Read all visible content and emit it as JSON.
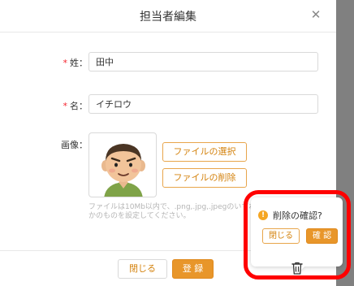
{
  "modal": {
    "title": "担当者編集",
    "close_icon": "close-icon"
  },
  "form": {
    "last_name": {
      "label": "姓：",
      "value": "田中",
      "required": true
    },
    "first_name": {
      "label": "名：",
      "value": "イチロウ",
      "required": true
    },
    "image": {
      "label": "画像：",
      "select_button": "ファイルの選択",
      "delete_button": "ファイルの削除",
      "hint": "ファイルは10Mb以内で、.png,.jpg,.jpegのいずれかのものを設定してください。"
    }
  },
  "footer": {
    "close_button": "閉じる",
    "register_button": "登 録",
    "delete_icon": "trash-icon"
  },
  "popconfirm": {
    "message": "削除の確認?",
    "icon": "warning-icon",
    "cancel_button": "閉じる",
    "confirm_button": "確 認"
  },
  "colors": {
    "accent": "#e8962a",
    "accent_text": "#d4830f",
    "required": "#f5222d",
    "highlight": "#ff0000"
  }
}
